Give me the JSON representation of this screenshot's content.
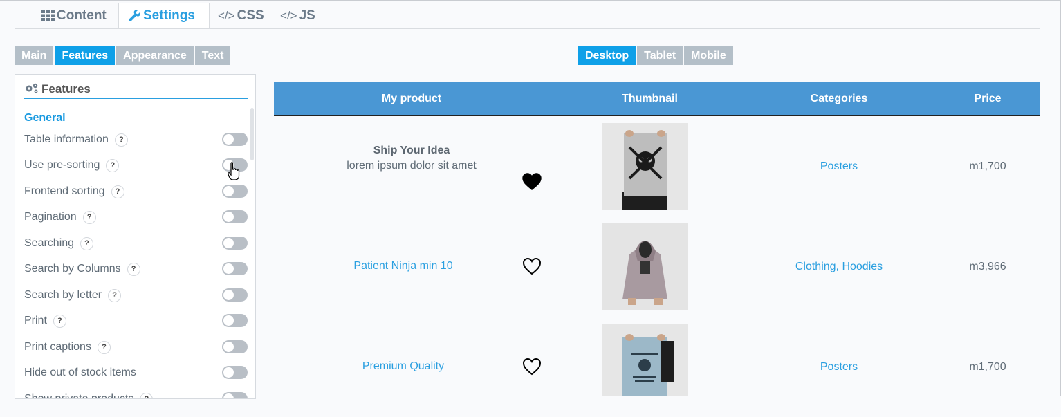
{
  "main_tabs": [
    {
      "label": "Content",
      "icon": "grid-icon"
    },
    {
      "label": "Settings",
      "icon": "wrench-icon"
    },
    {
      "label": "CSS",
      "icon": "code-icon"
    },
    {
      "label": "JS",
      "icon": "code-icon"
    }
  ],
  "left_subtabs": [
    "Main",
    "Features",
    "Appearance",
    "Text"
  ],
  "device_tabs": [
    "Desktop",
    "Tablet",
    "Mobile"
  ],
  "features_panel": {
    "title": "Features",
    "section": "General",
    "help_glyph": "?",
    "items": [
      {
        "label": "Table information",
        "enabled": false
      },
      {
        "label": "Use pre-sorting",
        "enabled": false
      },
      {
        "label": "Frontend sorting",
        "enabled": false
      },
      {
        "label": "Pagination",
        "enabled": false
      },
      {
        "label": "Searching",
        "enabled": false
      },
      {
        "label": "Search by Columns",
        "enabled": false
      },
      {
        "label": "Search by letter",
        "enabled": false
      },
      {
        "label": "Print",
        "enabled": false
      },
      {
        "label": "Print captions",
        "enabled": false
      },
      {
        "label": "Hide out of stock items",
        "enabled": false
      },
      {
        "label": "Show private products",
        "enabled": false
      }
    ]
  },
  "table": {
    "columns": [
      "My product",
      "",
      "Thumbnail",
      "Categories",
      "Price"
    ],
    "rows": [
      {
        "title": "Ship Your Idea",
        "description": "lorem ipsum dolor sit amet",
        "favorite": true,
        "categories": "Posters",
        "price": "m1,700"
      },
      {
        "title": "Patient Ninja min 10",
        "description": "",
        "favorite": false,
        "categories": "Clothing, Hoodies",
        "price": "m3,966"
      },
      {
        "title": "Premium Quality",
        "description": "",
        "favorite": false,
        "categories": "Posters",
        "price": "m1,700"
      }
    ]
  },
  "colors": {
    "accent": "#2a9fe0",
    "header_bg": "#4a97d4",
    "tab_inactive": "#b4bfc8",
    "toggle_off": "#b9bfc6"
  }
}
